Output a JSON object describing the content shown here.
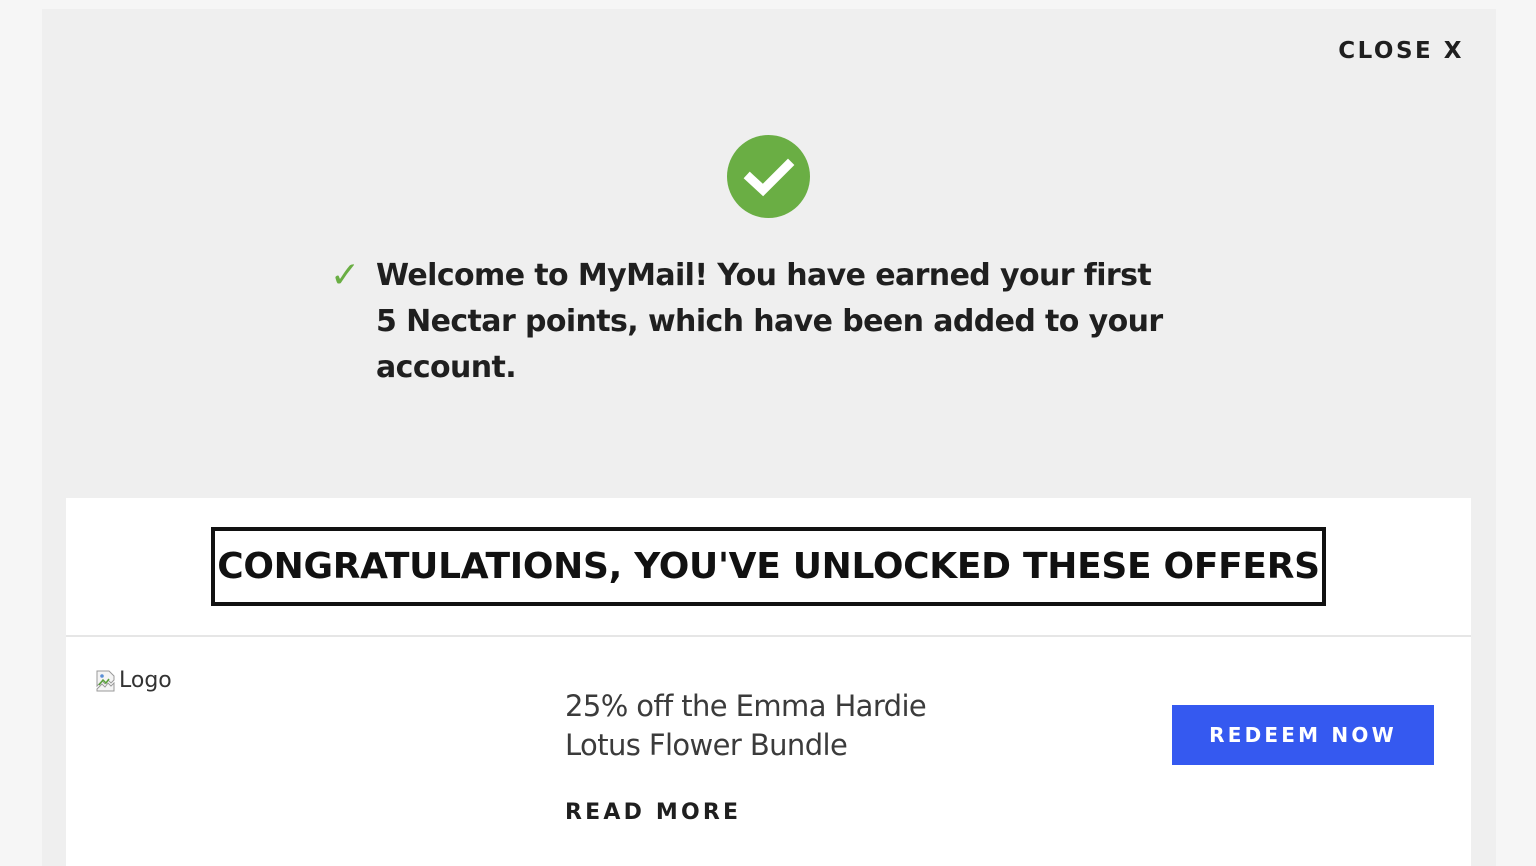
{
  "modal": {
    "close_label": "CLOSE X",
    "status_icon": "checkmark-circle-icon",
    "success_color": "#6aae44",
    "welcome_tick": "✓",
    "welcome_message": "Welcome to MyMail! You have earned your first 5 Nectar points, which have been added to your account."
  },
  "offers": {
    "heading": "CONGRATULATIONS, YOU'VE UNLOCKED THESE OFFERS",
    "items": [
      {
        "logo_alt": "Logo",
        "title": "25% off the Emma Hardie Lotus Flower Bundle",
        "read_more_label": "READ MORE",
        "redeem_label": "REDEEM NOW",
        "redeem_color": "#3559f0"
      }
    ]
  }
}
